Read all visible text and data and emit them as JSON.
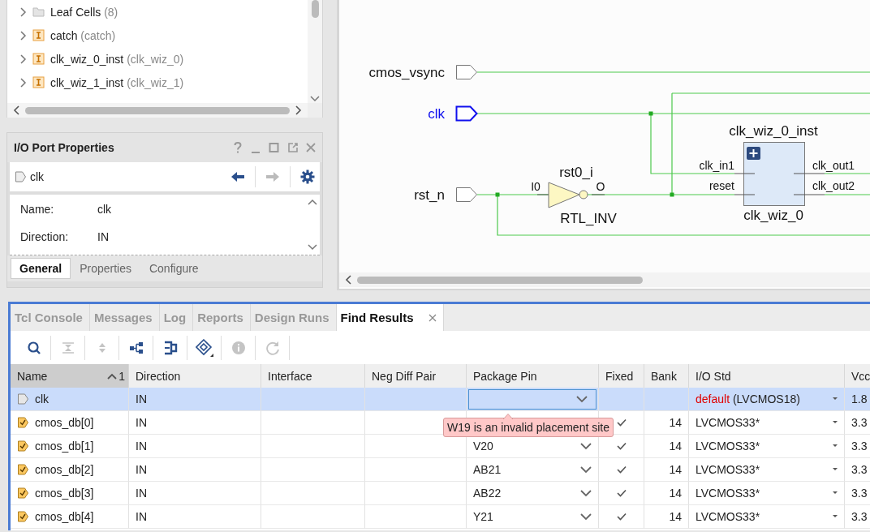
{
  "hierarchy_tree": {
    "items": [
      {
        "label": "Leaf Cells",
        "detail": "(8)",
        "kind": "folder",
        "expanded": false
      },
      {
        "label": "catch",
        "detail": "(catch)",
        "kind": "instance",
        "expanded": false
      },
      {
        "label": "clk_wiz_0_inst",
        "detail": "(clk_wiz_0)",
        "kind": "instance",
        "expanded": false
      },
      {
        "label": "clk_wiz_1_inst",
        "detail": "(clk_wiz_1)",
        "kind": "instance",
        "expanded": false
      }
    ]
  },
  "properties_panel": {
    "title": "I/O Port Properties",
    "object": "clk",
    "fields": [
      {
        "label": "Name:",
        "value": "clk"
      },
      {
        "label": "Direction:",
        "value": "IN"
      }
    ],
    "tabs": [
      {
        "label": "General",
        "selected": true
      },
      {
        "label": "Properties",
        "selected": false
      },
      {
        "label": "Configure",
        "selected": false
      }
    ]
  },
  "schematic": {
    "ports": [
      {
        "name": "cmos_vsync",
        "selected": false
      },
      {
        "name": "clk",
        "selected": true
      },
      {
        "name": "rst_n",
        "selected": false
      }
    ],
    "inverter": {
      "name": "rst0_i",
      "type": "RTL_INV",
      "input": "I0",
      "output": "O"
    },
    "block": {
      "name": "clk_wiz_0_inst",
      "type": "clk_wiz_0",
      "inputs": [
        "clk_in1",
        "reset"
      ],
      "outputs": [
        "clk_out1",
        "clk_out2"
      ]
    }
  },
  "bottom_panel": {
    "tabs": [
      {
        "label": "Tcl Console",
        "selected": false,
        "closable": false
      },
      {
        "label": "Messages",
        "selected": false,
        "closable": false
      },
      {
        "label": "Log",
        "selected": false,
        "closable": false
      },
      {
        "label": "Reports",
        "selected": false,
        "closable": false
      },
      {
        "label": "Design Runs",
        "selected": false,
        "closable": false
      },
      {
        "label": "Find Results",
        "selected": true,
        "closable": true
      }
    ],
    "toolbar": [
      {
        "kind": "search",
        "disabled": false
      },
      {
        "kind": "collapse",
        "disabled": true
      },
      {
        "kind": "expand",
        "disabled": true
      },
      {
        "kind": "hierarchy",
        "disabled": false
      },
      {
        "kind": "schematic",
        "disabled": false
      },
      {
        "kind": "diamond",
        "disabled": false
      },
      {
        "kind": "info",
        "disabled": true
      },
      {
        "kind": "refresh",
        "disabled": true
      }
    ],
    "table": {
      "columns": [
        {
          "label": "Name",
          "sort": "1"
        },
        {
          "label": "Direction"
        },
        {
          "label": "Interface"
        },
        {
          "label": "Neg Diff Pair"
        },
        {
          "label": "Package Pin"
        },
        {
          "label": "Fixed"
        },
        {
          "label": "Bank"
        },
        {
          "label": "I/O Std"
        },
        {
          "label": "Vcc"
        }
      ],
      "rows": [
        {
          "name": "clk",
          "placed": false,
          "selected": true,
          "direction": "IN",
          "package_pin_editing": true,
          "fixed": false,
          "io_std_default": "default",
          "io_std": "(LVCMOS18)",
          "vcco": "1.8"
        },
        {
          "name": "cmos_db[0]",
          "placed": true,
          "selected": false,
          "direction": "IN",
          "fixed": true,
          "bank": "14",
          "io_std": "LVCMOS33*",
          "vcco": "3.3"
        },
        {
          "name": "cmos_db[1]",
          "placed": true,
          "selected": false,
          "direction": "IN",
          "package_pin": "V20",
          "fixed": true,
          "bank": "14",
          "io_std": "LVCMOS33*",
          "vcco": "3.3"
        },
        {
          "name": "cmos_db[2]",
          "placed": true,
          "selected": false,
          "direction": "IN",
          "package_pin": "AB21",
          "fixed": true,
          "bank": "14",
          "io_std": "LVCMOS33*",
          "vcco": "3.3"
        },
        {
          "name": "cmos_db[3]",
          "placed": true,
          "selected": false,
          "direction": "IN",
          "package_pin": "AB22",
          "fixed": true,
          "bank": "14",
          "io_std": "LVCMOS33*",
          "vcco": "3.3"
        },
        {
          "name": "cmos_db[4]",
          "placed": true,
          "selected": false,
          "direction": "IN",
          "package_pin": "Y21",
          "fixed": true,
          "bank": "14",
          "io_std": "LVCMOS33*",
          "vcco": "3.3"
        }
      ]
    },
    "tooltip": "W19 is an invalid placement site"
  }
}
